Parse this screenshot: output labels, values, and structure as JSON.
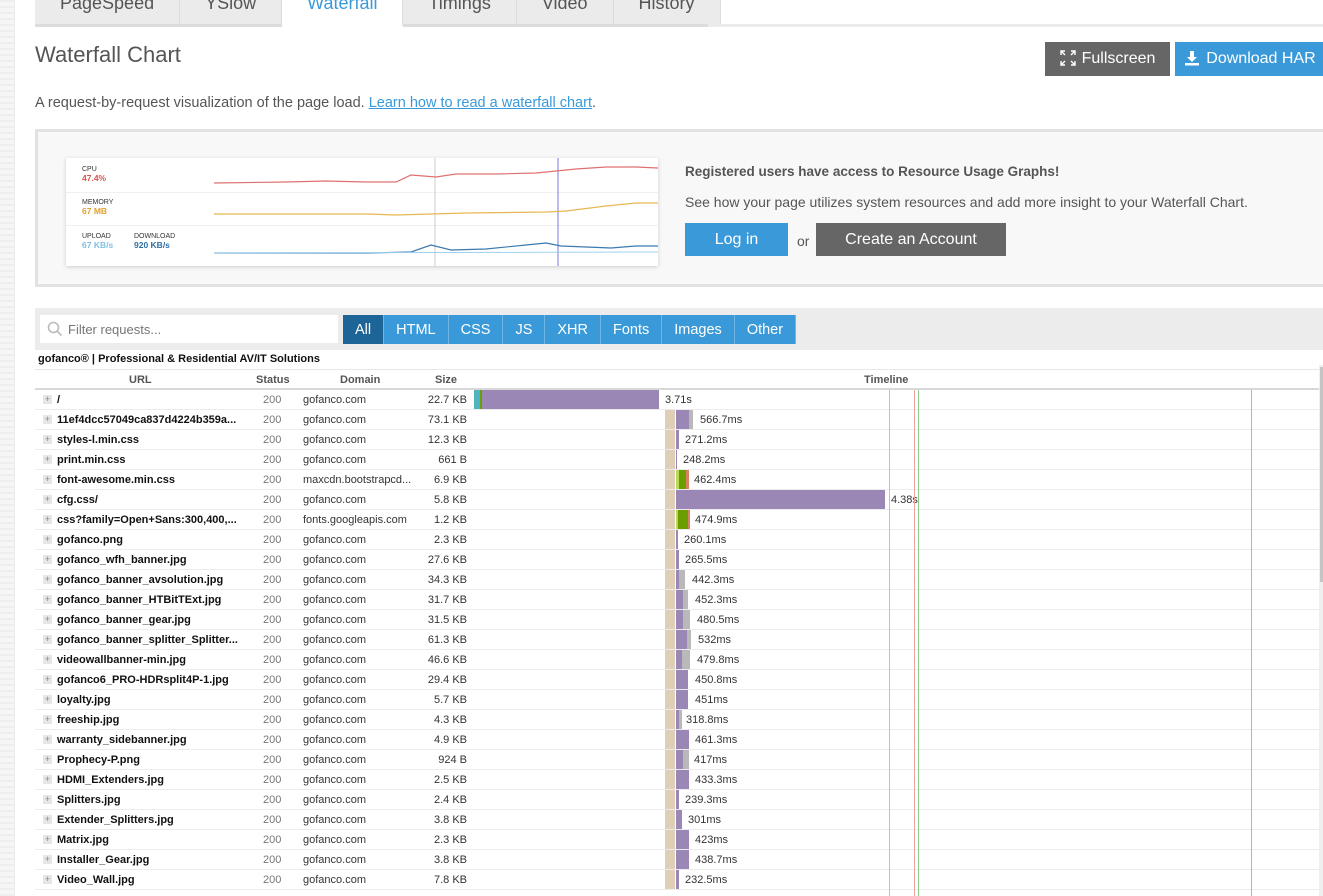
{
  "tabs": [
    {
      "label": "PageSpeed",
      "active": false
    },
    {
      "label": "YSlow",
      "active": false
    },
    {
      "label": "Waterfall",
      "active": true
    },
    {
      "label": "Timings",
      "active": false
    },
    {
      "label": "Video",
      "active": false
    },
    {
      "label": "History",
      "active": false
    }
  ],
  "header": {
    "title": "Waterfall Chart",
    "fullscreen_label": "Fullscreen",
    "download_label": "Download HAR",
    "subtitle": "A request-by-request visualization of the page load. ",
    "subtitle_link": "Learn how to read a waterfall chart",
    "subtitle_end": "."
  },
  "promo": {
    "cpu_label": "CPU",
    "cpu_value": "47.4%",
    "memory_label": "MEMORY",
    "memory_value": "67 MB",
    "upload_label": "UPLOAD",
    "upload_value": "67 KB/s",
    "download_label": "DOWNLOAD",
    "download_value": "920 KB/s",
    "title": "Registered users have access to Resource Usage Graphs!",
    "text": "See how your page utilizes system resources and add more insight to your Waterfall Chart.",
    "login_label": "Log in",
    "or_label": "or",
    "create_label": "Create an Account",
    "colors": {
      "cpu": "#d9534f",
      "memory": "#e0a030",
      "upload": "#7fbfe6",
      "download": "#2c6fa8"
    }
  },
  "toolbar": {
    "filter_placeholder": "Filter requests...",
    "filters": [
      {
        "label": "All",
        "active": true
      },
      {
        "label": "HTML",
        "active": false
      },
      {
        "label": "CSS",
        "active": false
      },
      {
        "label": "JS",
        "active": false
      },
      {
        "label": "XHR",
        "active": false
      },
      {
        "label": "Fonts",
        "active": false
      },
      {
        "label": "Images",
        "active": false
      },
      {
        "label": "Other",
        "active": false
      }
    ]
  },
  "table": {
    "page_name": "gofanco® | Professional & Residential AV/IT Solutions",
    "columns": {
      "url": "URL",
      "status": "Status",
      "domain": "Domain",
      "size": "Size",
      "timeline": "Timeline"
    },
    "colors": {
      "blocking": "#dfcfb6",
      "dns": "#4fb3c0",
      "connect": "#b7d85b",
      "ssl": "#6b9d00",
      "wait": "#9b87b6",
      "receive": "#b9b9b9",
      "error_tail": "#d88060"
    },
    "rows": [
      {
        "url": "/",
        "status": "200",
        "domain": "gofanco.com",
        "size": "22.7 KB",
        "duration": "3.71s"
      },
      {
        "url": "11ef4dcc57049ca837d4224b359a...",
        "status": "200",
        "domain": "gofanco.com",
        "size": "73.1 KB",
        "duration": "566.7ms"
      },
      {
        "url": "styles-l.min.css",
        "status": "200",
        "domain": "gofanco.com",
        "size": "12.3 KB",
        "duration": "271.2ms"
      },
      {
        "url": "print.min.css",
        "status": "200",
        "domain": "gofanco.com",
        "size": "661 B",
        "duration": "248.2ms"
      },
      {
        "url": "font-awesome.min.css",
        "status": "200",
        "domain": "maxcdn.bootstrapcd...",
        "size": "6.9 KB",
        "duration": "462.4ms"
      },
      {
        "url": "cfg.css/",
        "status": "200",
        "domain": "gofanco.com",
        "size": "5.8 KB",
        "duration": "4.38s"
      },
      {
        "url": "css?family=Open+Sans:300,400,...",
        "status": "200",
        "domain": "fonts.googleapis.com",
        "size": "1.2 KB",
        "duration": "474.9ms"
      },
      {
        "url": "gofanco.png",
        "status": "200",
        "domain": "gofanco.com",
        "size": "2.3 KB",
        "duration": "260.1ms"
      },
      {
        "url": "gofanco_wfh_banner.jpg",
        "status": "200",
        "domain": "gofanco.com",
        "size": "27.6 KB",
        "duration": "265.5ms"
      },
      {
        "url": "gofanco_banner_avsolution.jpg",
        "status": "200",
        "domain": "gofanco.com",
        "size": "34.3 KB",
        "duration": "442.3ms"
      },
      {
        "url": "gofanco_banner_HTBitTExt.jpg",
        "status": "200",
        "domain": "gofanco.com",
        "size": "31.7 KB",
        "duration": "452.3ms"
      },
      {
        "url": "gofanco_banner_gear.jpg",
        "status": "200",
        "domain": "gofanco.com",
        "size": "31.5 KB",
        "duration": "480.5ms"
      },
      {
        "url": "gofanco_banner_splitter_Splitter...",
        "status": "200",
        "domain": "gofanco.com",
        "size": "61.3 KB",
        "duration": "532ms"
      },
      {
        "url": "videowallbanner-min.jpg",
        "status": "200",
        "domain": "gofanco.com",
        "size": "46.6 KB",
        "duration": "479.8ms"
      },
      {
        "url": "gofanco6_PRO-HDRsplit4P-1.jpg",
        "status": "200",
        "domain": "gofanco.com",
        "size": "29.4 KB",
        "duration": "450.8ms"
      },
      {
        "url": "loyalty.jpg",
        "status": "200",
        "domain": "gofanco.com",
        "size": "5.7 KB",
        "duration": "451ms"
      },
      {
        "url": "freeship.jpg",
        "status": "200",
        "domain": "gofanco.com",
        "size": "4.3 KB",
        "duration": "318.8ms"
      },
      {
        "url": "warranty_sidebanner.jpg",
        "status": "200",
        "domain": "gofanco.com",
        "size": "4.9 KB",
        "duration": "461.3ms"
      },
      {
        "url": "Prophecy-P.png",
        "status": "200",
        "domain": "gofanco.com",
        "size": "924 B",
        "duration": "417ms"
      },
      {
        "url": "HDMI_Extenders.jpg",
        "status": "200",
        "domain": "gofanco.com",
        "size": "2.5 KB",
        "duration": "433.3ms"
      },
      {
        "url": "Splitters.jpg",
        "status": "200",
        "domain": "gofanco.com",
        "size": "2.4 KB",
        "duration": "239.3ms"
      },
      {
        "url": "Extender_Splitters.jpg",
        "status": "200",
        "domain": "gofanco.com",
        "size": "3.8 KB",
        "duration": "301ms"
      },
      {
        "url": "Matrix.jpg",
        "status": "200",
        "domain": "gofanco.com",
        "size": "2.3 KB",
        "duration": "423ms"
      },
      {
        "url": "Installer_Gear.jpg",
        "status": "200",
        "domain": "gofanco.com",
        "size": "3.8 KB",
        "duration": "438.7ms"
      },
      {
        "url": "Video_Wall.jpg",
        "status": "200",
        "domain": "gofanco.com",
        "size": "7.8 KB",
        "duration": "232.5ms"
      }
    ]
  }
}
